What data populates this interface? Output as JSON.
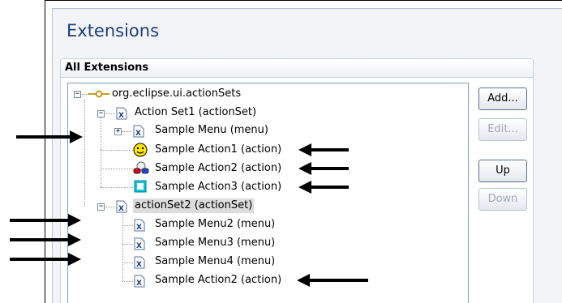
{
  "editor": {
    "title": "Extensions",
    "section_title": "All Extensions"
  },
  "tree": {
    "root": {
      "label": "org.eclipse.ui.actionSets",
      "icon": "extension-point-icon",
      "expanded": true
    },
    "items": [
      {
        "label": "Action Set1 (actionSet)",
        "icon": "xml-element-icon",
        "expanded": true
      },
      {
        "label": "Sample Menu (menu)",
        "icon": "xml-element-icon",
        "expanded": false
      },
      {
        "label": "Sample Action1 (action)",
        "icon": "smiley-icon"
      },
      {
        "label": "Sample Action2 (action)",
        "icon": "glasses-icon"
      },
      {
        "label": "Sample Action3 (action)",
        "icon": "cyan-square-icon"
      },
      {
        "label": "actionSet2 (actionSet)",
        "icon": "xml-element-icon",
        "expanded": true,
        "selected": true
      },
      {
        "label": "Sample Menu2 (menu)",
        "icon": "xml-element-icon"
      },
      {
        "label": "Sample Menu3 (menu)",
        "icon": "xml-element-icon"
      },
      {
        "label": "Sample Menu4 (menu)",
        "icon": "xml-element-icon"
      },
      {
        "label": "Sample Action2 (action)",
        "icon": "xml-element-icon"
      }
    ]
  },
  "buttons": {
    "add": {
      "label": "Add...",
      "enabled": true
    },
    "edit": {
      "label": "Edit...",
      "enabled": false
    },
    "up": {
      "label": "Up",
      "enabled": true
    },
    "down": {
      "label": "Down",
      "enabled": false
    }
  },
  "colors": {
    "title": "#1f3d7a",
    "selection": "#dcdcdc",
    "annotation_arrow": "#000000"
  }
}
